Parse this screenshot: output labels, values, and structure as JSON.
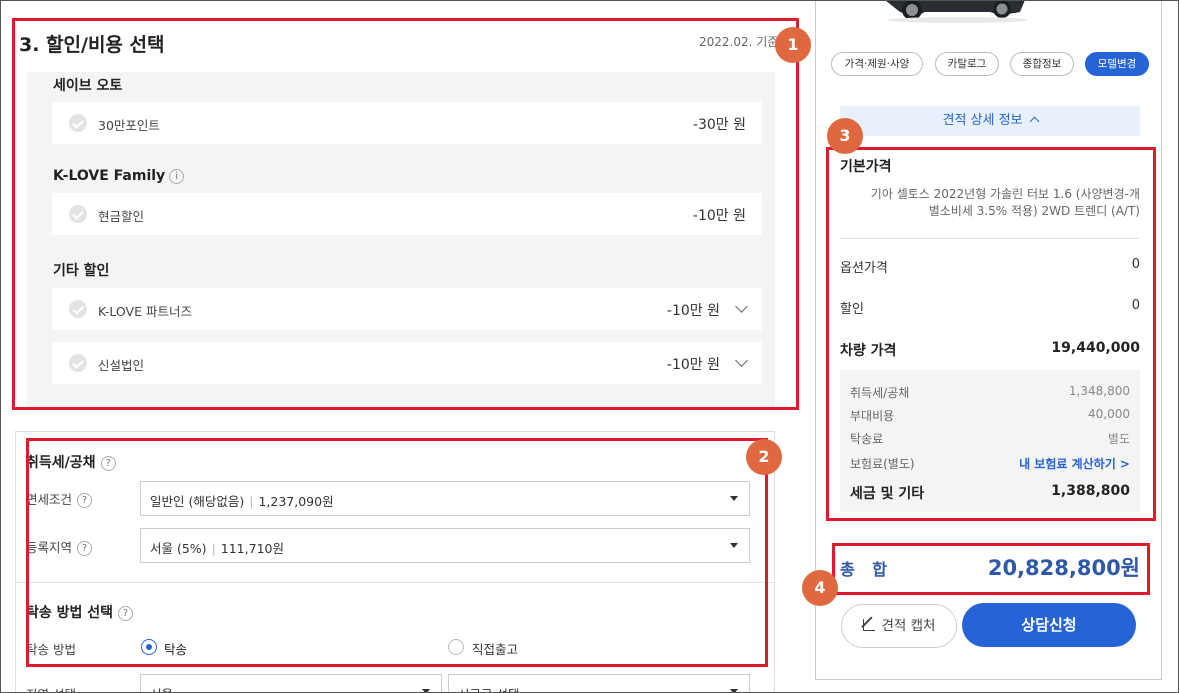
{
  "discount_section": {
    "title": "3. 할인/비용 선택",
    "date_basis": "2022.02. 기준",
    "groups": [
      {
        "title": "세이브 오토",
        "info": "",
        "items": [
          {
            "label": "30만포인트",
            "value": "-30만 원"
          }
        ]
      },
      {
        "title": "K-LOVE Family",
        "info": "i",
        "items": [
          {
            "label": "현금할인",
            "value": "-10만 원"
          }
        ]
      },
      {
        "title": "기타 할인",
        "info": "",
        "items": [
          {
            "label": "K-LOVE 파트너즈",
            "value": "-10만 원"
          },
          {
            "label": "신설법인",
            "value": "-10만 원"
          }
        ]
      }
    ]
  },
  "tax_section": {
    "title": "취득세/공채",
    "help": "?",
    "rows": [
      {
        "label": "면세조건",
        "help": "?",
        "value": "일반인 (해당없음)",
        "amount": "1,237,090원"
      },
      {
        "label": "등록지역",
        "help": "?",
        "value": "서울 (5%)",
        "amount": "111,710원"
      }
    ]
  },
  "delivery_section": {
    "title": "탁송 방법 선택",
    "help": "?",
    "method_label": "탁송 방법",
    "options": [
      {
        "label": "탁송",
        "selected": true
      },
      {
        "label": "직접출고",
        "selected": false
      }
    ],
    "region_label": "지역 선택",
    "region_value": "서울",
    "city_placeholder": "시군구 선택"
  },
  "sidebar": {
    "pills": [
      "가격·제원·사양",
      "카탈로그",
      "종합정보",
      "모델변경"
    ],
    "active_pill": "모델변경",
    "detail_toggle": "견적 상세 정보",
    "base_price": {
      "title": "기본가격",
      "description_line1": "기아 셀토스 2022년형 가솔린 터보 1.6 (사양변경-개",
      "description_line2": "별소비세 3.5% 적용) 2WD 트렌디 (A/T)"
    },
    "option_price": {
      "label": "옵션가격",
      "value": "0"
    },
    "discount": {
      "label": "할인",
      "value": "0"
    },
    "vehicle_price": {
      "label": "차량 가격",
      "value": "19,440,000"
    },
    "fees": [
      {
        "label": "취득세/공채",
        "value": "1,348,800"
      },
      {
        "label": "부대비용",
        "value": "40,000"
      },
      {
        "label": "탁송료",
        "value": "별도"
      },
      {
        "label": "보험료(별도)",
        "value": "내 보험료 계산하기 >"
      }
    ],
    "tax_total": {
      "label": "세금 및 기타",
      "value": "1,388,800"
    },
    "total": {
      "label": "총 합",
      "value": "20,828,800원"
    },
    "capture_button": "견적 캡처",
    "consult_button": "상담신청"
  },
  "annotations": {
    "markers": [
      "1",
      "2",
      "3",
      "4"
    ],
    "color": "#e0192b",
    "marker_color": "#e06840"
  },
  "colors": {
    "accent": "#2563d6",
    "total_text": "#2f59a8"
  }
}
